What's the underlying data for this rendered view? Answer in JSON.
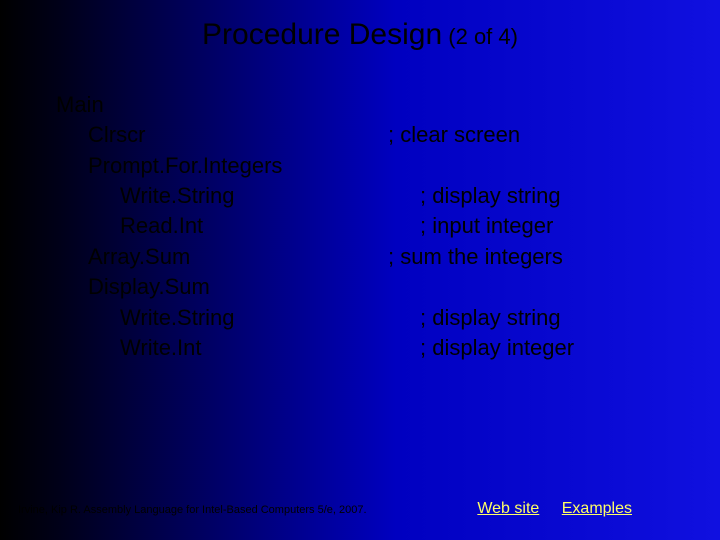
{
  "title": {
    "main": "Procedure Design",
    "sub": " (2 of 4)"
  },
  "lines": [
    {
      "indent": 0,
      "text": "Main",
      "comment": ""
    },
    {
      "indent": 1,
      "text": "Clrscr",
      "comment": "; clear screen"
    },
    {
      "indent": 1,
      "text": "Prompt.For.Integers",
      "comment": ""
    },
    {
      "indent": 2,
      "text": "Write.String",
      "comment": "; display string"
    },
    {
      "indent": 2,
      "text": "Read.Int",
      "comment": "; input integer"
    },
    {
      "indent": 1,
      "text": "Array.Sum",
      "comment": "; sum the integers"
    },
    {
      "indent": 1,
      "text": "Display.Sum",
      "comment": ""
    },
    {
      "indent": 2,
      "text": "Write.String",
      "comment": "; display string"
    },
    {
      "indent": 2,
      "text": "Write.Int",
      "comment": "; display integer"
    }
  ],
  "footer": "Irvine, Kip R. Assembly Language for Intel-Based Computers 5/e, 2007.",
  "links": {
    "website": "Web site",
    "examples": "Examples"
  }
}
